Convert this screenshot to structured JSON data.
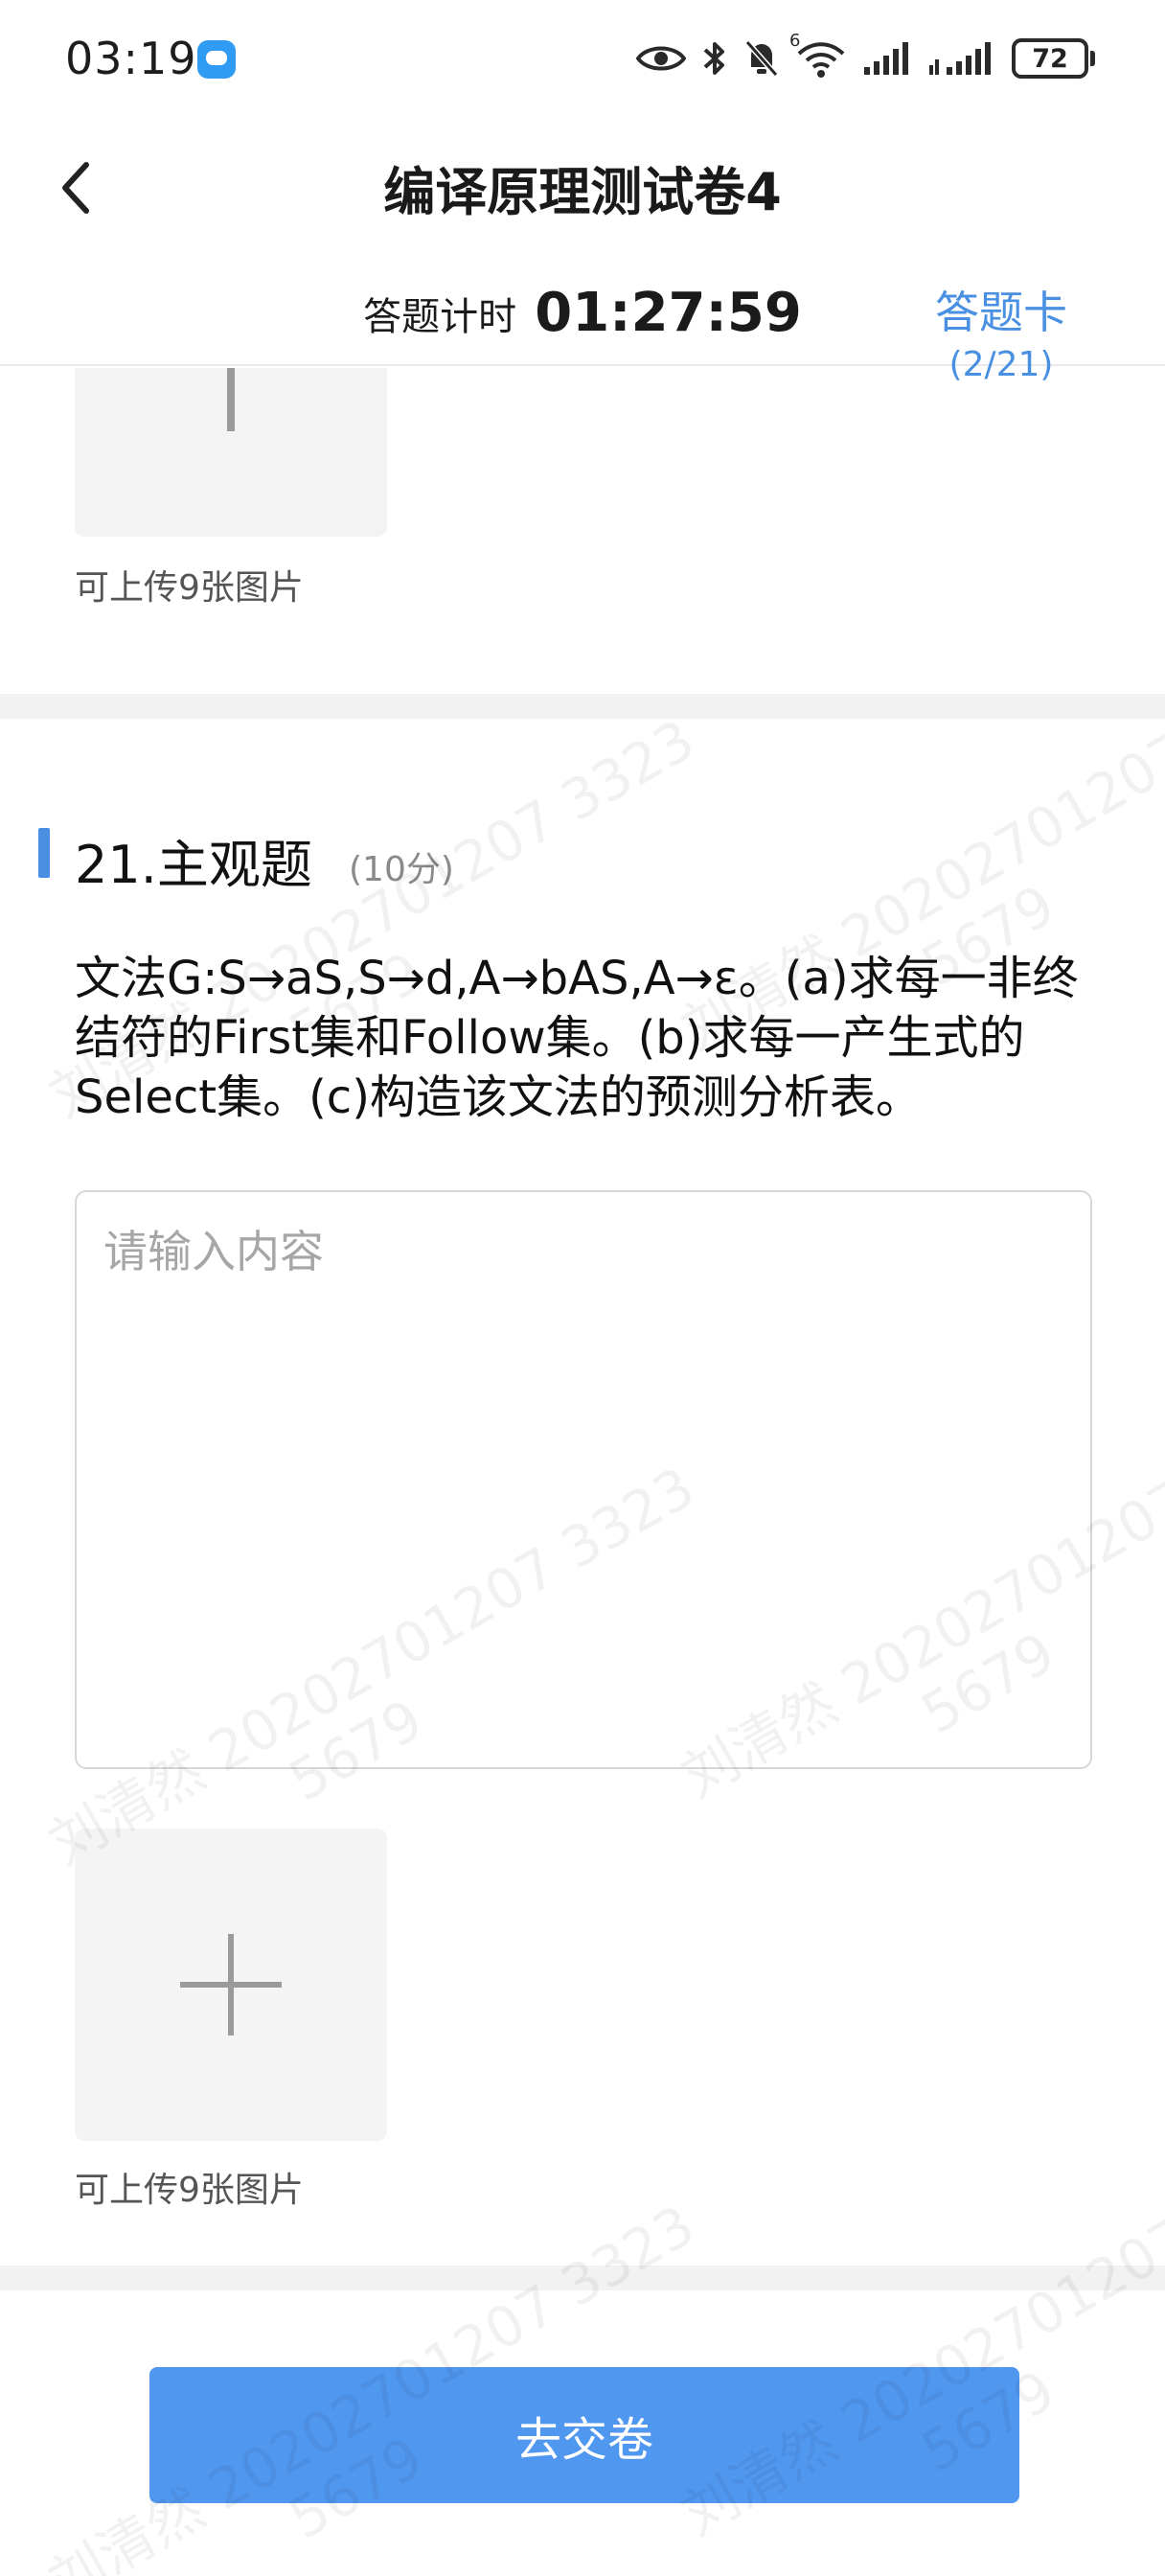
{
  "status_bar": {
    "time": "03:19",
    "battery": "72",
    "network_label": "6"
  },
  "header": {
    "title": "编译原理测试卷4",
    "timer_label": "答题计时",
    "timer_value": "01:27:59",
    "answer_card_label": "答题卡",
    "answer_card_count": "(2/21)"
  },
  "previous_question": {
    "upload_hint": "可上传9张图片"
  },
  "question": {
    "title": "21.主观题",
    "score": "(10分)",
    "body": "文法G:S→aS,S→d,A→bAS,A→ε。(a)求每一非终结符的First集和Follow集。(b)求每一产生式的Select集。(c)构造该文法的预测分析表。",
    "input_placeholder": "请输入内容",
    "input_value": "",
    "upload_hint": "可上传9张图片"
  },
  "footer": {
    "submit_label": "去交卷"
  },
  "watermark": {
    "name": "刘清然",
    "id": "20202701207 3323",
    "code": "5679"
  },
  "colors": {
    "accent": "#4a90e2",
    "submit_bg": "#5097f0",
    "separator": "#f2f2f2"
  }
}
